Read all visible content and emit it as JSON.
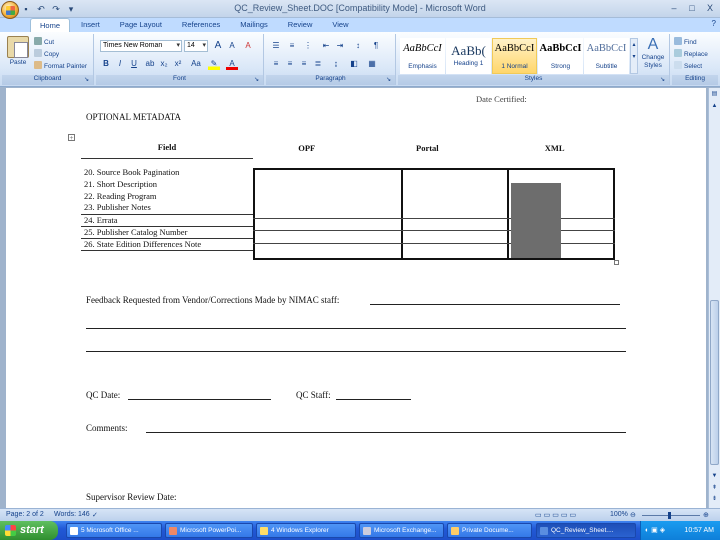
{
  "window": {
    "title": "QC_Review_Sheet.DOC [Compatibility Mode] - Microsoft Word",
    "controls": [
      "–",
      "□",
      "X"
    ]
  },
  "tabs": [
    {
      "label": "Home",
      "active": true
    },
    {
      "label": "Insert"
    },
    {
      "label": "Page Layout"
    },
    {
      "label": "References"
    },
    {
      "label": "Mailings"
    },
    {
      "label": "Review"
    },
    {
      "label": "View"
    }
  ],
  "ribbon": {
    "clipboard": {
      "label": "Clipboard",
      "paste": "Paste",
      "cut": "Cut",
      "copy": "Copy",
      "format_painter": "Format Painter"
    },
    "font": {
      "label": "Font",
      "name": "Times New Roman",
      "size": "14",
      "bold": "B",
      "italic": "I",
      "underline": "U",
      "grow": "A",
      "shrink": "A",
      "clear": "A"
    },
    "paragraph": {
      "label": "Paragraph",
      "pilcrow": "¶"
    },
    "styles": {
      "label": "Styles",
      "items": [
        {
          "sample": "AaBbCcI",
          "name": "Emphasis"
        },
        {
          "sample": "AaBb(",
          "name": "Heading 1"
        },
        {
          "sample": "AaBbCcI",
          "name": "1 Normal",
          "selected": true
        },
        {
          "sample": "AaBbCcI",
          "name": "Strong"
        },
        {
          "sample": "AaBbCcI",
          "name": "Subtitle"
        }
      ],
      "change_styles": "Change Styles"
    },
    "editing": {
      "label": "Editing",
      "find": "Find",
      "replace": "Replace",
      "select": "Select"
    }
  },
  "document": {
    "date_certified": "Date Certified:",
    "optional_metadata": "OPTIONAL METADATA",
    "table": {
      "headers": [
        "Field",
        "OPF",
        "Portal",
        "XML"
      ],
      "rows": [
        "20. Source Book Pagination",
        "21. Short Description",
        "22. Reading Program",
        "23. Publisher Notes",
        "24. Errata",
        "25. Publisher Catalog Number",
        "26. State Edition Differences Note"
      ]
    },
    "feedback": "Feedback Requested from Vendor/Corrections Made by NIMAC staff:",
    "qc_date": "QC Date:",
    "qc_staff": "QC Staff:",
    "comments": "Comments:",
    "supervisor": "Supervisor Review Date:"
  },
  "statusbar": {
    "page": "Page: 2 of 2",
    "words": "Words: 146",
    "zoom": "100%"
  },
  "taskbar": {
    "start": "start",
    "tasks": [
      {
        "label": "5 Microsoft Office ..."
      },
      {
        "label": "Microsoft PowerPoi..."
      },
      {
        "label": "4 Windows Explorer"
      },
      {
        "label": "Microsoft Exchange..."
      },
      {
        "label": "Private Docume..."
      },
      {
        "label": "QC_Review_Sheet....",
        "active": true
      }
    ],
    "clock": "10:57 AM"
  },
  "colors": {
    "ribbon_text": "#15428b",
    "taskbar": "#2259d6",
    "start": "#2f8f2f",
    "xml_shading": "#6d6d6d"
  }
}
